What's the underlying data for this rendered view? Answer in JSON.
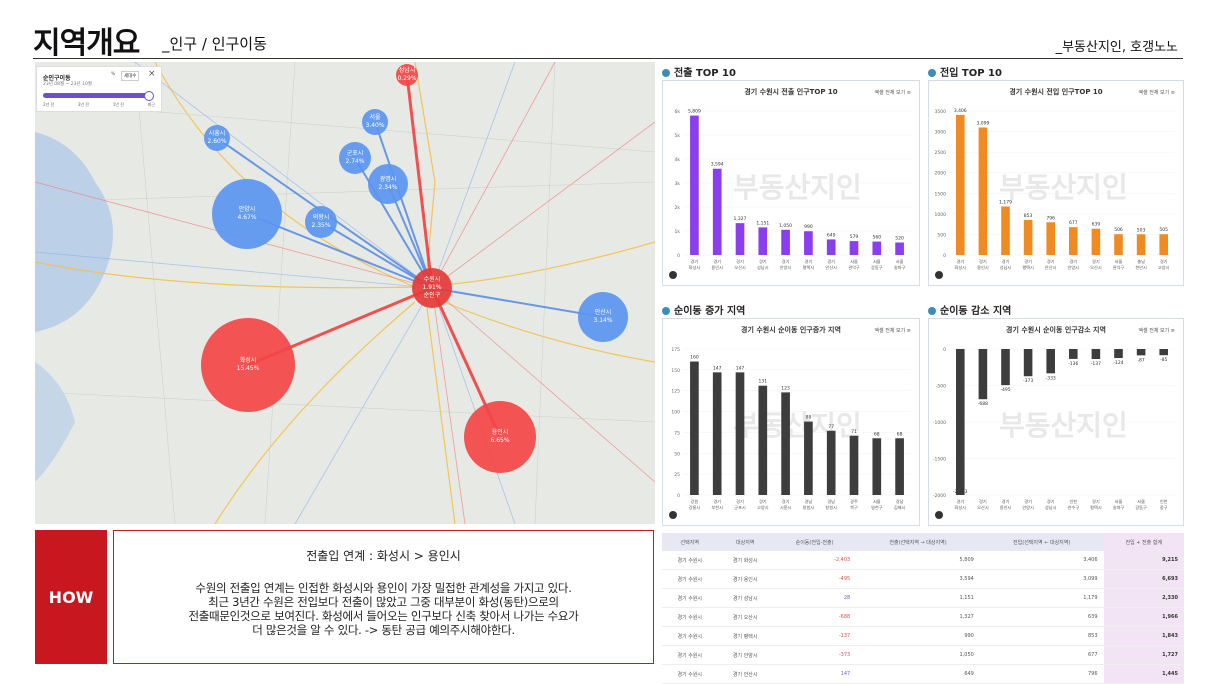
{
  "header": {
    "title": "지역개요",
    "subtitle": "_인구 / 인구이동",
    "credit": "_부동산지인, 호갱노노"
  },
  "map": {
    "legend": {
      "title": "순인구이동",
      "range": "23년 08월 ~ 23년 10월",
      "button": "세대수",
      "ticks": [
        "2년 전",
        "3년 전",
        "1년 전",
        "최근"
      ]
    },
    "bubbles": [
      {
        "name": "수원시",
        "pct": "1.91%",
        "label3": "순인구",
        "color": "#e63a3a"
      },
      {
        "name": "화성시",
        "pct": "15.45%",
        "color": "#f44545"
      },
      {
        "name": "용인시",
        "pct": "6.65%",
        "color": "#f44545"
      },
      {
        "name": "안양시",
        "pct": "4.67%",
        "color": "#5b95f0"
      },
      {
        "name": "안산시",
        "pct": "3.14%",
        "color": "#5b95f0"
      },
      {
        "name": "군포시",
        "pct": "2.74%",
        "color": "#5b95f0"
      },
      {
        "name": "의왕시",
        "pct": "2.35%",
        "color": "#5b95f0"
      },
      {
        "name": "시흥시",
        "pct": "2.60%",
        "color": "#5b95f0"
      },
      {
        "name": "광명시",
        "pct": "2.34%",
        "color": "#5b95f0"
      },
      {
        "name": "서울",
        "pct": "3.40%",
        "color": "#5b95f0"
      },
      {
        "name": "성남시",
        "pct": "0.29%",
        "color": "#f44545"
      }
    ]
  },
  "chart_out": {
    "section": "전출 TOP 10",
    "menu": "엑셀 전체 보기",
    "chart_data": {
      "type": "bar",
      "title": "경기 수원시 전출 인구TOP 10",
      "categories": [
        "경기 화성시",
        "경기 용인시",
        "경기 오산시",
        "경기 성남시",
        "경기 안양시",
        "경기 평택시",
        "경기 안산시",
        "서울 관악구",
        "서울 강동구",
        "서울 송파구"
      ],
      "values": [
        5809,
        3594,
        1327,
        1151,
        1050,
        990,
        649,
        579,
        560,
        520
      ],
      "ylim": [
        0,
        6000
      ],
      "yticks": [
        "0",
        "1k",
        "2k",
        "3k",
        "4k",
        "5k",
        "6k"
      ],
      "color": "#8b3df0"
    }
  },
  "chart_in": {
    "section": "전입 TOP 10",
    "menu": "엑셀 전체 보기",
    "chart_data": {
      "type": "bar",
      "title": "경기 수원시 전입 인구TOP 10",
      "categories": [
        "경기 화성시",
        "경기 용인시",
        "경기 성남시",
        "경기 평택시",
        "경기 안산시",
        "경기 안양시",
        "경기 오산시",
        "서울 관악구",
        "충남 천안시",
        "경기 고양시"
      ],
      "values": [
        3406,
        3099,
        1179,
        853,
        796,
        677,
        639,
        506,
        503,
        505
      ],
      "ylim": [
        0,
        3500
      ],
      "yticks": [
        "0",
        "500",
        "1000",
        "1500",
        "2000",
        "2500",
        "3000",
        "3500"
      ],
      "color": "#f28a22"
    }
  },
  "chart_inc": {
    "section": "순이동 증가 지역",
    "menu": "엑셀 전체 보기",
    "chart_data": {
      "type": "bar",
      "title": "경기 수원시 순이동 인구증가 지역",
      "categories": [
        "강원 강릉시",
        "경기 부천시",
        "경기 군포시",
        "경기 고양시",
        "경기 시흥시",
        "경남 창원시",
        "경남 창원시",
        "광주 북구",
        "서울 영천구",
        "경남 김해시"
      ],
      "values": [
        160,
        147,
        147,
        131,
        123,
        88,
        77,
        71,
        68,
        68
      ],
      "ylim": [
        0,
        175
      ],
      "yticks": [
        "0",
        "25",
        "50",
        "75",
        "100",
        "125",
        "150",
        "175"
      ],
      "color": "#3d3d3d"
    }
  },
  "chart_dec": {
    "section": "순이동 감소 지역",
    "menu": "엑셀 전체 보기",
    "chart_data": {
      "type": "bar",
      "title": "경기 수원시 순이동 인구감소 지역",
      "categories": [
        "경기 화성시",
        "경기 오산시",
        "경기 용인시",
        "경기 안양시",
        "경기 성남시",
        "인천 연수구",
        "경기 평택시",
        "서울 송파구",
        "서울 강동구",
        "인천 중구"
      ],
      "values": [
        -2403,
        -688,
        -495,
        -373,
        -333,
        -136,
        -137,
        -124,
        -87,
        -85
      ],
      "ylim": [
        -2000,
        0
      ],
      "yticks": [
        "0",
        "-500",
        "-1000",
        "-1500",
        "-2000"
      ],
      "color": "#3d3d3d"
    }
  },
  "how": {
    "label": "HOW",
    "heading": "전출입 연계 : 화성시 > 용인시",
    "lines": [
      "수원의 전출입 연계는 인접한 화성시와 용인이 가장 밀접한 관계성을 가지고 있다.",
      "최근 3년간 수원은 전입보다 전출이 많았고 그중 대부분이 화성(동탄)으로의",
      "전출때문인것으로 보여진다. 화성에서 들어오는 인구보다 신축 찾아서 나가는 수요가",
      "더 많은것을 알 수 있다. -> 동탄 공급 예의주시해야한다."
    ]
  },
  "table": {
    "headers": [
      "선택지역",
      "대상지역",
      "순이동(전입-전출)",
      "전출(선택지역 → 대상지역)",
      "전입(선택지역 ← 대상지역)",
      "전입 + 전출 합계"
    ],
    "rows": [
      [
        "경기 수원시",
        "경기 화성시",
        "-2,403",
        "5,809",
        "3,406",
        "9,215"
      ],
      [
        "경기 수원시",
        "경기 용인시",
        "-495",
        "3,594",
        "3,099",
        "6,693"
      ],
      [
        "경기 수원시",
        "경기 성남시",
        "28",
        "1,151",
        "1,179",
        "2,330"
      ],
      [
        "경기 수원시",
        "경기 오산시",
        "-688",
        "1,327",
        "639",
        "1,966"
      ],
      [
        "경기 수원시",
        "경기 평택시",
        "-137",
        "990",
        "853",
        "1,843"
      ],
      [
        "경기 수원시",
        "경기 안양시",
        "-373",
        "1,050",
        "677",
        "1,727"
      ],
      [
        "경기 수원시",
        "경기 안산시",
        "147",
        "649",
        "796",
        "1,445"
      ]
    ]
  }
}
